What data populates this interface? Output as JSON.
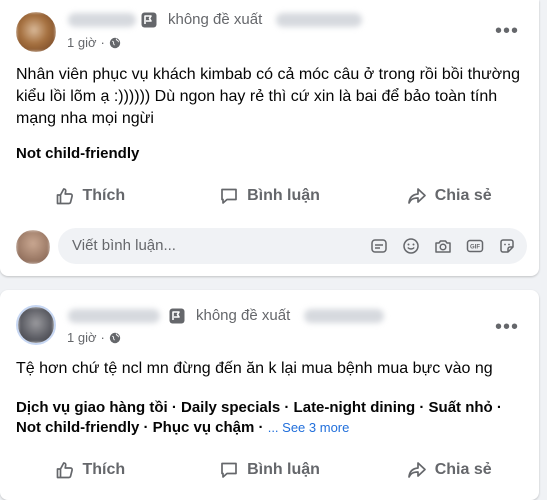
{
  "colors": {
    "background": "#f0f2f5",
    "card": "#ffffff",
    "secondary_text": "#65676b",
    "link": "#216fdb"
  },
  "post1": {
    "recommendation": "không đề xuất",
    "time": "1 giờ",
    "body": "Nhân viên phục vụ khách kimbab có cả móc câu ở trong rồi bồi thường kiểu lồi lõm ạ :)))))) Dù ngon hay rẻ thì cứ xin là bai để bảo toàn tính mạng nha mọi ngừi",
    "tags": "Not child-friendly",
    "actions": {
      "like": "Thích",
      "comment": "Bình luận",
      "share": "Chia sẻ"
    },
    "comment_placeholder": "Viết bình luận..."
  },
  "post2": {
    "recommendation": "không đề xuất",
    "time": "1 giờ",
    "body": "Tệ hơn chứ tệ ncl mn đừng đến ăn k lại mua bệnh mua bực vào ng",
    "tags_line1": "Dịch vụ giao hàng tồi · Daily specials · Late-night dining · Suất nhỏ ·",
    "tags_line2": "Not child-friendly · Phục vụ chậm ·",
    "see_more": "... See 3 more",
    "actions": {
      "like": "Thích",
      "comment": "Bình luận",
      "share": "Chia sẻ"
    }
  }
}
